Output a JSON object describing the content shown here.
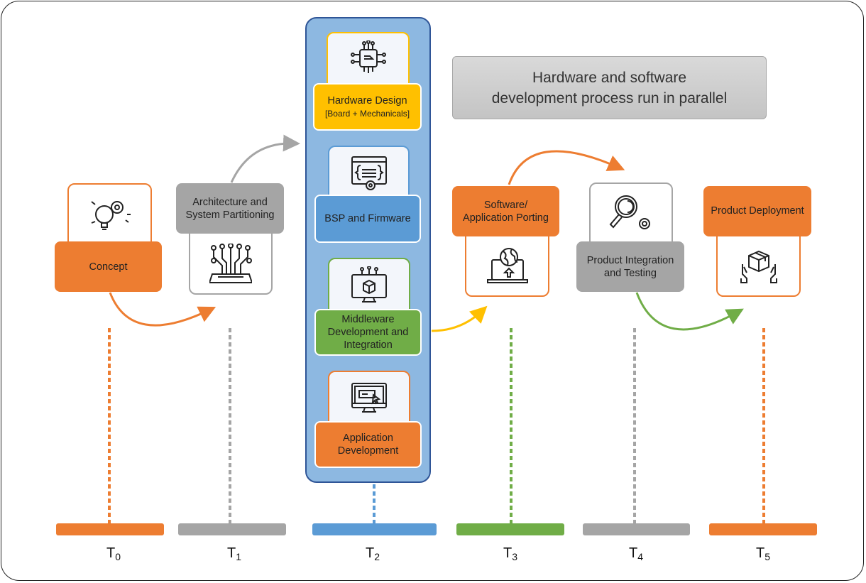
{
  "title": {
    "line1": "Hardware and software",
    "line2": "development process run in parallel"
  },
  "colors": {
    "orange": "#ed7d31",
    "gray": "#a5a5a5",
    "blue": "#5b9bd5",
    "green": "#70ad47",
    "yellow": "#ffc000",
    "column_bg": "#8db8e1",
    "column_border": "#2f5597"
  },
  "stages": {
    "concept": {
      "label": "Concept",
      "icon": "lightbulb-gears-icon"
    },
    "architecture": {
      "line1": "Architecture and",
      "line2": "System Partitioning",
      "icon": "circuit-board-icon"
    },
    "hardware": {
      "line1": "Hardware Design",
      "line2": "[Board + Mechanicals]",
      "icon": "chip-icon"
    },
    "bsp": {
      "label": "BSP and Firmware",
      "icon": "code-window-gear-icon"
    },
    "middleware": {
      "line1": "Middleware",
      "line2": "Development and",
      "line3": "Integration",
      "icon": "monitor-cube-icon"
    },
    "application": {
      "line1": "Application",
      "line2": "Development",
      "icon": "monitor-cursor-icon"
    },
    "porting": {
      "line1": "Software/",
      "line2": "Application Porting",
      "icon": "laptop-globe-upload-icon"
    },
    "integration": {
      "line1": "Product Integration",
      "line2": "and Testing",
      "icon": "magnifier-gear-icon"
    },
    "deployment": {
      "label": "Product Deployment",
      "icon": "hands-box-icon"
    }
  },
  "timeline": [
    {
      "t": "T",
      "sub": "0"
    },
    {
      "t": "T",
      "sub": "1"
    },
    {
      "t": "T",
      "sub": "2"
    },
    {
      "t": "T",
      "sub": "3"
    },
    {
      "t": "T",
      "sub": "4"
    },
    {
      "t": "T",
      "sub": "5"
    }
  ]
}
